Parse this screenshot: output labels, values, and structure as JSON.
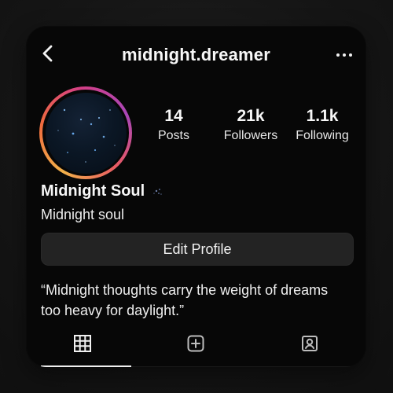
{
  "header": {
    "username": "midnight.dreamer"
  },
  "stats": [
    {
      "value": "14",
      "label": "Posts"
    },
    {
      "value": "21k",
      "label": "Followers"
    },
    {
      "value": "1.1k",
      "label": "Following"
    }
  ],
  "profile": {
    "display_name": "Midnight Soul",
    "subtitle": "Midnight soul",
    "edit_button_label": "Edit Profile",
    "bio_quote": "“Midnight thoughts carry the weight of dreams too heavy for daylight.”"
  },
  "icons": {
    "back": "chevron-left-icon",
    "more": "more-horizontal-icon",
    "grid": "grid-icon",
    "add": "add-square-icon",
    "tagged": "user-tag-icon",
    "sparkle": "sparkle-icon"
  },
  "colors": {
    "background": "#151515",
    "card": "#070707",
    "button": "#232323",
    "text": "#f5f5f5",
    "ring_start": "#f2b14a",
    "ring_mid": "#d43f86",
    "ring_end": "#a846b8"
  }
}
